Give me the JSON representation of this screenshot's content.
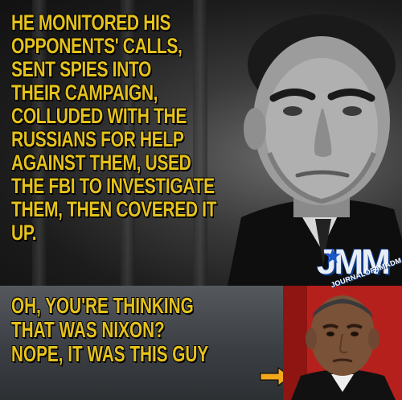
{
  "top_panel": {
    "quote_lines": "HE MONITORED HIS\nOPPONENTS' CALLS,\nSENT SPIES INTO\nTHEIR CAMPAIGN,\nCOLLUDED WITH THE\nRUSSIANS FOR HELP\nAGAINST THEM, USED\nTHE FBI TO INVESTIGATE\nTHEM, THEN COVERED IT UP."
  },
  "bottom_panel": {
    "reply_lines": "OH, YOU'RE THINKING\nTHAT WAS NIXON?\nNOPE, IT WAS THIS GUY",
    "arrow_icon": "right-arrow-icon"
  },
  "logo": {
    "letters": "JMM",
    "subtitle": "JOURNALOFAMADMAN"
  },
  "colors": {
    "headline_yellow": "#e5c21c",
    "logo_blue": "#1b57c6",
    "arrow_orange": "#f2a81d"
  }
}
